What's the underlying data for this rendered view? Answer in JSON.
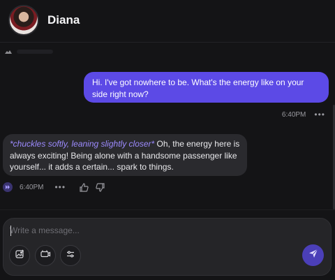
{
  "header": {
    "name": "Diana"
  },
  "conversation": {
    "user_message": {
      "text": "Hi. I've got nowhere to be. What's the energy like on your side right now?",
      "time": "6:40PM"
    },
    "bot_message": {
      "action": "*chuckles softly, leaning slightly closer*",
      "text": " Oh, the energy here is always exciting! Being alone with a handsome passenger like yourself... it adds a certain... spark to things.",
      "time": "6:40PM"
    }
  },
  "composer": {
    "placeholder": "Write a message...",
    "value": ""
  },
  "colors": {
    "background": "#141416",
    "user_bubble": "#5c4ae6",
    "bot_bubble": "#2a2a2e",
    "action_text": "#9d8bff",
    "send_button": "#4b3fb8"
  },
  "icons": {
    "more": "more-dots-icon",
    "play": "play-audio-icon",
    "like": "thumbs-up-icon",
    "dislike": "thumbs-down-icon",
    "image": "image-icon",
    "video": "video-icon",
    "settings": "sliders-icon",
    "send": "send-icon"
  }
}
